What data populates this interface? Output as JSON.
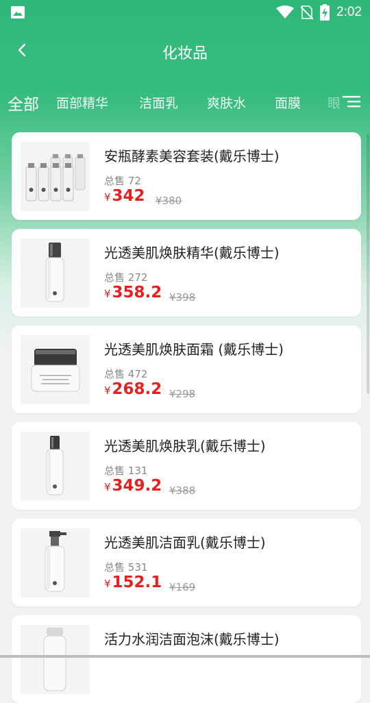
{
  "status_bar": {
    "time": "2:02",
    "icons": [
      "image-icon",
      "wifi-icon",
      "no-sim-icon",
      "battery-charging-icon"
    ]
  },
  "header": {
    "title": "化妆品",
    "back_icon": "chevron-left-icon",
    "menu_icon": "hamburger-menu-icon"
  },
  "tabs": [
    {
      "label": "全部"
    },
    {
      "label": "面部精华"
    },
    {
      "label": "洁面乳"
    },
    {
      "label": "爽肤水"
    },
    {
      "label": "面膜"
    },
    {
      "label": "眼"
    }
  ],
  "sold_prefix": "总售",
  "currency": "¥",
  "products": [
    {
      "name": "安瓶酵素美容套装(戴乐博士)",
      "sold": "72",
      "price": "342",
      "original_price": "¥380",
      "image": "ampoule-set"
    },
    {
      "name": "光透美肌焕肤精华(戴乐博士)",
      "sold": "272",
      "price": "358.2",
      "original_price": "¥398",
      "image": "essence-bottle"
    },
    {
      "name": "光透美肌焕肤面霜 (戴乐博士)",
      "sold": "472",
      "price": "268.2",
      "original_price": "¥298",
      "image": "cream-jar"
    },
    {
      "name": "光透美肌焕肤乳(戴乐博士)",
      "sold": "131",
      "price": "349.2",
      "original_price": "¥388",
      "image": "lotion-bottle"
    },
    {
      "name": "光透美肌洁面乳(戴乐博士)",
      "sold": "531",
      "price": "152.1",
      "original_price": "¥169",
      "image": "cleanser-pump"
    },
    {
      "name": "活力水润洁面泡沫(戴乐博士)",
      "sold": "",
      "price": "",
      "original_price": "",
      "image": "foam-bottle"
    }
  ],
  "colors": {
    "brand_green": "#2fb879",
    "price_red": "#e5201f",
    "muted": "#888888"
  }
}
